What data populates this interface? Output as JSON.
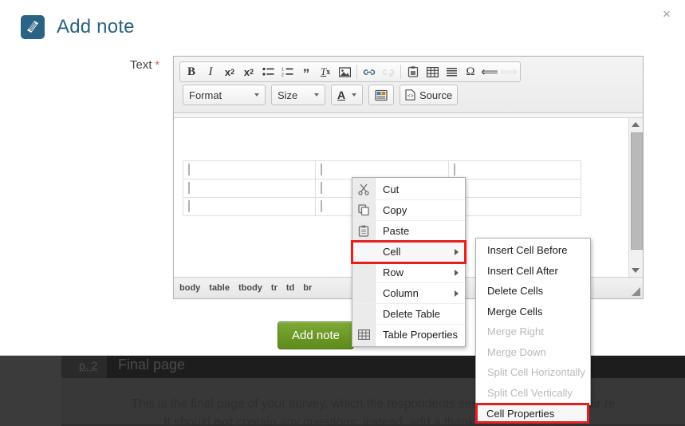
{
  "modal": {
    "title": "Add note",
    "title_icon": "note-icon",
    "close_icon": "×",
    "field_label": "Text",
    "required_marker": "*",
    "submit_label": "Add note",
    "accent_color": "#2a6383",
    "submit_color": "#6d9a27",
    "highlight_color": "#e62020"
  },
  "editor": {
    "toolbar_row1": [
      {
        "name": "bold",
        "glyph": "B",
        "disabled": false
      },
      {
        "name": "italic",
        "glyph": "I",
        "disabled": false
      },
      {
        "name": "subscript",
        "glyph": "x₂",
        "disabled": false
      },
      {
        "name": "superscript",
        "glyph": "x²",
        "disabled": false
      },
      {
        "name": "bulleted-list",
        "glyph": "☰",
        "disabled": false
      },
      {
        "name": "numbered-list",
        "glyph": "☰",
        "disabled": false
      },
      {
        "name": "blockquote",
        "glyph": "❞",
        "disabled": false
      },
      {
        "name": "remove-format",
        "glyph": "Tx",
        "disabled": false
      },
      {
        "name": "image",
        "glyph": "▣",
        "disabled": false
      },
      {
        "name": "link",
        "glyph": "🔗",
        "disabled": false
      },
      {
        "name": "unlink",
        "glyph": "🔗",
        "disabled": true
      },
      {
        "name": "paste-from-word",
        "glyph": "📋",
        "disabled": false
      },
      {
        "name": "table",
        "glyph": "▦",
        "disabled": false
      },
      {
        "name": "horizontal-rule",
        "glyph": "≡",
        "disabled": false
      },
      {
        "name": "special-character",
        "glyph": "Ω",
        "disabled": false
      },
      {
        "name": "undo",
        "glyph": "↶",
        "disabled": false
      },
      {
        "name": "redo",
        "glyph": "↷",
        "disabled": true
      }
    ],
    "toolbar_row2": {
      "format_label": "Format",
      "size_label": "Size",
      "text_color_label": "A",
      "templates_label": "templates-icon",
      "source_label": "Source"
    },
    "elements_path": [
      "body",
      "table",
      "tbody",
      "tr",
      "td",
      "br"
    ],
    "table_rows": 3,
    "table_cols": 3
  },
  "context_menu": {
    "items": [
      {
        "label": "Cut",
        "icon": "scissors-icon",
        "submenu": false,
        "highlighted": false
      },
      {
        "label": "Copy",
        "icon": "copy-icon",
        "submenu": false,
        "highlighted": false
      },
      {
        "label": "Paste",
        "icon": "clipboard-icon",
        "submenu": false,
        "highlighted": false
      },
      {
        "label": "Cell",
        "icon": "",
        "submenu": true,
        "highlighted": true
      },
      {
        "label": "Row",
        "icon": "",
        "submenu": true,
        "highlighted": false
      },
      {
        "label": "Column",
        "icon": "",
        "submenu": true,
        "highlighted": false
      },
      {
        "label": "Delete Table",
        "icon": "",
        "submenu": false,
        "highlighted": false
      },
      {
        "label": "Table Properties",
        "icon": "table-icon",
        "submenu": false,
        "highlighted": false
      }
    ]
  },
  "cell_submenu": {
    "items": [
      {
        "label": "Insert Cell Before",
        "disabled": false
      },
      {
        "label": "Insert Cell After",
        "disabled": false
      },
      {
        "label": "Delete Cells",
        "disabled": false
      },
      {
        "label": "Merge Cells",
        "disabled": false
      },
      {
        "label": "Merge Right",
        "disabled": true
      },
      {
        "label": "Merge Down",
        "disabled": true
      },
      {
        "label": "Split Cell Horizontally",
        "disabled": true
      },
      {
        "label": "Split Cell Vertically",
        "disabled": true
      }
    ],
    "highlighted_item": "Cell Properties"
  },
  "background_page": {
    "page_number": "p. 2",
    "page_title": "Final page",
    "line1": "This is the final page of your survey, which the respondents see after they submit their re",
    "line2_prefix": "It should ",
    "line2_bold": "not",
    "line2_suffix": " contain any questions; instead, add a thank you message or de"
  }
}
